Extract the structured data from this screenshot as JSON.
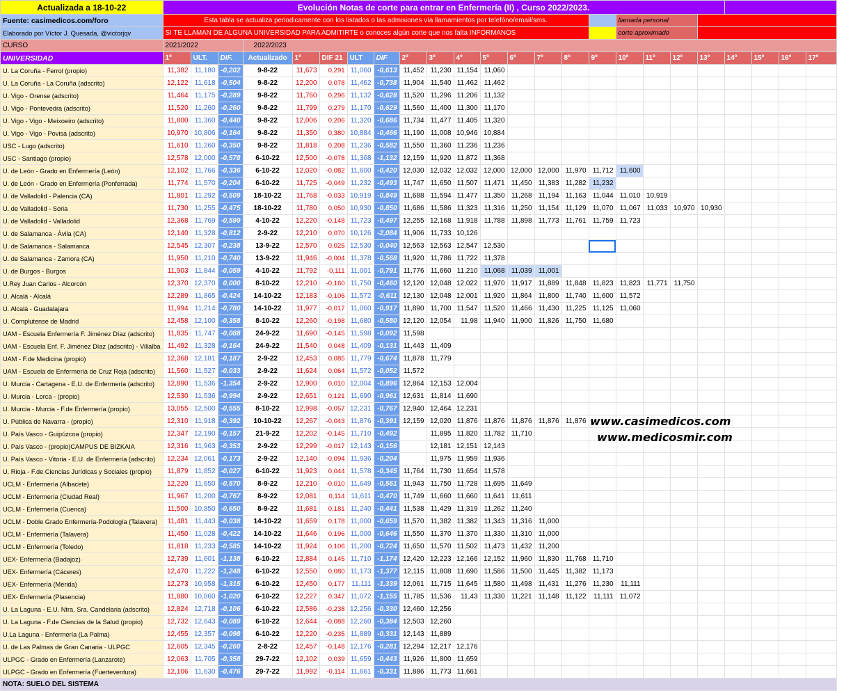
{
  "header": {
    "updated": "Actualizada a 18-10-22",
    "title": "Evolución Notas de corte para entrar en Enfermería (II) , Curso 2022/2023.",
    "source": "Fuente: casimedicos.com/foro",
    "note1": "Esta tabla se actualiza periodicamente con los listados o las admisiones vía llamamientos por telefóno/email/sms.",
    "author": "Elaborado por Víctor J. Quesada, @victorjqv",
    "note2": "SI TE LLAMAN DE ALGUNA UNIVERSIDAD PARA ADMITIRTE o conoces algún corte que nos falta INFÓRMANOS",
    "legend_personal": "llamada personal",
    "legend_aprox": "corte aproximado",
    "curso_label": "CURSO",
    "curso_prev": "2021/2022",
    "curso_curr": "2022/2023"
  },
  "columns": {
    "uni": "UNIVERSIDAD",
    "first_prev": "1º",
    "last_prev": "ULT.",
    "dif_prev": "DIF.",
    "updated": "Actualizado",
    "first": "1º",
    "dif21": "DIF 21",
    "last": "ULT",
    "dif": "DIF",
    "calls": [
      "2º",
      "3º",
      "4º",
      "5º",
      "6º",
      "7º",
      "8º",
      "9º",
      "10º",
      "11º",
      "12º",
      "13º",
      "14º",
      "15º",
      "16º",
      "17º"
    ]
  },
  "rows": [
    {
      "name": "U. La Coruña - Ferrol  (propio)",
      "p1": "11,382",
      "pu": "11,180",
      "pd": "-0,202",
      "upd": "9-8-22",
      "c1": "11,673",
      "d21": "0,291",
      "cu": "11,060",
      "cd": "-0,613",
      "calls": [
        "11,452",
        "11,230",
        "11,154",
        "11,060"
      ]
    },
    {
      "name": "U. La Coruña - La Coruña (adscrito)",
      "p1": "12,122",
      "pu": "11,618",
      "pd": "-0,504",
      "upd": "9-8-22",
      "c1": "12,200",
      "d21": "0,078",
      "cu": "11,462",
      "cd": "-0,738",
      "calls": [
        "11,904",
        "11,540",
        "11,462",
        "11,462"
      ]
    },
    {
      "name": "U. Vigo - Orense (adscrito)",
      "p1": "11,464",
      "pu": "11,175",
      "pd": "-0,289",
      "upd": "9-8-22",
      "c1": "11,760",
      "d21": "0,296",
      "cu": "11,132",
      "cd": "-0,628",
      "calls": [
        "11,520",
        "11,296",
        "11,206",
        "11,132"
      ]
    },
    {
      "name": "U. Vigo - Pontevedra (adscrito)",
      "p1": "11,520",
      "pu": "11,260",
      "pd": "-0,260",
      "upd": "9-8-22",
      "c1": "11,799",
      "d21": "0,279",
      "cu": "11,170",
      "cd": "-0,629",
      "calls": [
        "11,560",
        "11,400",
        "11,300",
        "11,170"
      ]
    },
    {
      "name": "U. Vigo - Vigo - Meixoeiro (adscrito)",
      "p1": "11,800",
      "pu": "11,360",
      "pd": "-0,440",
      "upd": "9-8-22",
      "c1": "12,006",
      "d21": "0,206",
      "cu": "11,320",
      "cd": "-0,686",
      "calls": [
        "11,734",
        "11,477",
        "11,405",
        "11,320"
      ]
    },
    {
      "name": "U. Vigo - Vigo - Povisa (adscrito)",
      "p1": "10,970",
      "pu": "10,806",
      "pd": "-0,164",
      "upd": "9-8-22",
      "c1": "11,350",
      "d21": "0,380",
      "cu": "10,884",
      "cd": "-0,466",
      "calls": [
        "11,190",
        "11,008",
        "10,946",
        "10,884"
      ]
    },
    {
      "name": "USC - Lugo  (adscrito)",
      "p1": "11,610",
      "pu": "11,260",
      "pd": "-0,350",
      "upd": "9-8-22",
      "c1": "11,818",
      "d21": "0,208",
      "cu": "11,236",
      "cd": "-0,582",
      "calls": [
        "11,550",
        "11,360",
        "11,236",
        "11,236"
      ]
    },
    {
      "name": "USC - Santiago  (propio)",
      "p1": "12,578",
      "pu": "12,000",
      "pd": "-0,578",
      "upd": "6-10-22",
      "c1": "12,500",
      "d21": "-0,078",
      "cu": "11,368",
      "cd": "-1,132",
      "calls": [
        "12,159",
        "11,920",
        "11,872",
        "11,368"
      ]
    },
    {
      "name": "U. de León - Grado en Enfermería (León)",
      "p1": "12,102",
      "pu": "11,766",
      "pd": "-0,336",
      "upd": "6-10-22",
      "c1": "12,020",
      "d21": "-0,082",
      "cu": "11,600",
      "cd": "-0,420",
      "calls": [
        "12,030",
        "12,032",
        "12,032",
        "12,000",
        "12,000",
        "12,000",
        "11,970",
        "11,712",
        "11,600"
      ],
      "hl": [
        8
      ]
    },
    {
      "name": "U. de León - Grado en Enfermería (Ponferrada)",
      "p1": "11,774",
      "pu": "11,570",
      "pd": "-0,204",
      "upd": "6-10-22",
      "c1": "11,725",
      "d21": "-0,049",
      "cu": "11,232",
      "cd": "-0,493",
      "calls": [
        "11,747",
        "11,650",
        "11,507",
        "11,471",
        "11,450",
        "11,383",
        "11,282",
        "11,232"
      ],
      "hl": [
        7
      ]
    },
    {
      "name": "U. de Valladolid - Palencia (CA)",
      "p1": "11,801",
      "pu": "11,292",
      "pd": "-0,509",
      "upd": "18-10-22",
      "c1": "11,768",
      "d21": "-0,033",
      "cu": "10,919",
      "cd": "-0,849",
      "calls": [
        "11,688",
        "11,594",
        "11,477",
        "11,350",
        "11,268",
        "11,194",
        "11,163",
        "11,044",
        "11,010",
        "10,919"
      ]
    },
    {
      "name": "U. de Valladolid - Soria",
      "p1": "11,730",
      "pu": "11,255",
      "pd": "-0,475",
      "upd": "18-10-22",
      "c1": "11,780",
      "d21": "0,050",
      "cu": "10,930",
      "cd": "-0,850",
      "calls": [
        "11,686",
        "11,586",
        "11,323",
        "11,316",
        "11,250",
        "11,154",
        "11,129",
        "11,070",
        "11,067",
        "11,033",
        "10,970",
        "10,930"
      ]
    },
    {
      "name": "U. de Valladolid - Valladolid",
      "p1": "12,368",
      "pu": "11,769",
      "pd": "-0,599",
      "upd": "4-10-22",
      "c1": "12,220",
      "d21": "-0,148",
      "cu": "11,723",
      "cd": "-0,497",
      "calls": [
        "12,255",
        "12,168",
        "11,918",
        "11,788",
        "11,898",
        "11,773",
        "11,761",
        "11,759",
        "11,723"
      ]
    },
    {
      "name": "U. de Salamanca - Ávila (CA)",
      "p1": "12,140",
      "pu": "11,328",
      "pd": "-0,812",
      "upd": "2-9-22",
      "c1": "12,210",
      "d21": "0,070",
      "cu": "10,126",
      "cd": "-2,084",
      "calls": [
        "11,906",
        "11,733",
        "10,126"
      ]
    },
    {
      "name": "U. de Salamanca - Salamanca",
      "p1": "12,545",
      "pu": "12,307",
      "pd": "-0,238",
      "upd": "13-9-22",
      "c1": "12,570",
      "d21": "0,025",
      "cu": "12,530",
      "cd": "-0,040",
      "calls": [
        "12,563",
        "12,563",
        "12,547",
        "12,530"
      ]
    },
    {
      "name": "U. de Salamanca - Zamora (CA)",
      "p1": "11,950",
      "pu": "11,210",
      "pd": "-0,740",
      "upd": "13-9-22",
      "c1": "11,946",
      "d21": "-0,004",
      "cu": "11,378",
      "cd": "-0,568",
      "calls": [
        "11,920",
        "11,786",
        "11,722",
        "11,378"
      ]
    },
    {
      "name": "U. de Burgos - Burgos",
      "p1": "11,903",
      "pu": "11,844",
      "pd": "-0,059",
      "upd": "4-10-22",
      "c1": "11,792",
      "d21": "-0,111",
      "cu": "11,001",
      "cd": "-0,791",
      "calls": [
        "11,776",
        "11,660",
        "11,210",
        "11,068",
        "11,039",
        "11,001"
      ],
      "hl": [
        3,
        4,
        5
      ]
    },
    {
      "name": "U.Rey Juan Carlos - Alcorcón",
      "p1": "12,370",
      "pu": "12,370",
      "pd": "0,000",
      "upd": "8-10-22",
      "c1": "12,210",
      "d21": "-0,160",
      "cu": "11,750",
      "cd": "-0,460",
      "calls": [
        "12,120",
        "12,048",
        "12,022",
        "11,970",
        "11,917",
        "11,889",
        "11,848",
        "11,823",
        "11,823",
        "11,771",
        "11,750"
      ]
    },
    {
      "name": "U. Alcalá - Alcalá",
      "p1": "12,289",
      "pu": "11,865",
      "pd": "-0,424",
      "upd": "14-10-22",
      "c1": "12,183",
      "d21": "-0,106",
      "cu": "11,572",
      "cd": "-0,611",
      "calls": [
        "12,130",
        "12,048",
        "12,001",
        "11,920",
        "11,864",
        "11,800",
        "11,740",
        "11,600",
        "11,572"
      ]
    },
    {
      "name": "U. Alcalá - Guadalajara",
      "p1": "11,994",
      "pu": "11,214",
      "pd": "-0,780",
      "upd": "14-10-22",
      "c1": "11,977",
      "d21": "-0,017",
      "cu": "11,060",
      "cd": "-0,917",
      "calls": [
        "11,890",
        "11,700",
        "11,547",
        "11,520",
        "11,466",
        "11,430",
        "11,225",
        "11,125",
        "11,060"
      ]
    },
    {
      "name": "U. Complutense de Madrid",
      "p1": "12,458",
      "pu": "12,100",
      "pd": "-0,358",
      "upd": "8-10-22",
      "c1": "12,260",
      "d21": "-0,198",
      "cu": "11,680",
      "cd": "-0,580",
      "calls": [
        "12,120",
        "12,054",
        "11,98",
        "11,940",
        "11,900",
        "11,826",
        "11,750",
        "11,680"
      ]
    },
    {
      "name": "UAM - Escuela Enfermería F. Jiménez Díaz (adscrito)",
      "p1": "11,835",
      "pu": "11,747",
      "pd": "-0,088",
      "upd": "24-9-22",
      "c1": "11,690",
      "d21": "-0,145",
      "cu": "11,598",
      "cd": "-0,092",
      "calls": [
        "11,598"
      ]
    },
    {
      "name": "UAM - Escuela Enf. F. Jiménez Díaz (adscrito) - Villalba",
      "p1": "11,492",
      "pu": "11,328",
      "pd": "-0,164",
      "upd": "24-9-22",
      "c1": "11,540",
      "d21": "0,048",
      "cu": "11,409",
      "cd": "-0,131",
      "calls": [
        "11,443",
        "11,409"
      ]
    },
    {
      "name": "UAM - F.de Medicina (propio)",
      "p1": "12,368",
      "pu": "12,181",
      "pd": "-0,187",
      "upd": "2-9-22",
      "c1": "12,453",
      "d21": "0,085",
      "cu": "11,779",
      "cd": "-0,674",
      "calls": [
        "11,878",
        "11,779"
      ]
    },
    {
      "name": "UAM - Escuela de Enfermería de Cruz Roja (adscrito)",
      "p1": "11,560",
      "pu": "11,527",
      "pd": "-0,033",
      "upd": "2-9-22",
      "c1": "11,624",
      "d21": "0,064",
      "cu": "11,572",
      "cd": "-0,052",
      "calls": [
        "11,572"
      ]
    },
    {
      "name": "U. Murcia - Cartagena - E.U. de Enfermería (adscrito)",
      "p1": "12,890",
      "pu": "11,536",
      "pd": "-1,354",
      "upd": "2-9-22",
      "c1": "12,900",
      "d21": "0,010",
      "cu": "12,004",
      "cd": "-0,896",
      "calls": [
        "12,864",
        "12,153",
        "12,004"
      ]
    },
    {
      "name": "U. Murcia - Lorca - (propio)",
      "p1": "12,530",
      "pu": "11,536",
      "pd": "-0,994",
      "upd": "2-9-22",
      "c1": "12,651",
      "d21": "0,121",
      "cu": "11,690",
      "cd": "-0,961",
      "calls": [
        "12,631",
        "11,814",
        "11,690"
      ]
    },
    {
      "name": "U. Murcia - Murcia - F.de Enfermería (propio)",
      "p1": "13,055",
      "pu": "12,500",
      "pd": "-0,555",
      "upd": "8-10-22",
      "c1": "12,998",
      "d21": "-0,057",
      "cu": "12,231",
      "cd": "-0,767",
      "calls": [
        "12,940",
        "12,464",
        "12,231"
      ]
    },
    {
      "name": "U. Pública de Navarra - (propio)",
      "p1": "12,310",
      "pu": "11,918",
      "pd": "-0,392",
      "upd": "10-10-22",
      "c1": "12,267",
      "d21": "-0,043",
      "cu": "11,876",
      "cd": "-0,391",
      "calls": [
        "12,159",
        "12,020",
        "11,876",
        "11,876",
        "11,876",
        "11,876",
        "11,876"
      ]
    },
    {
      "name": "U. País Vasco - Guipúzcoa (propio)",
      "p1": "12,347",
      "pu": "12,190",
      "pd": "-0,157",
      "upd": "21-9-22",
      "c1": "12,202",
      "d21": "-0,145",
      "cu": "11,710",
      "cd": "-0,492",
      "calls": [
        "",
        "11,895",
        "11,820",
        "11,782",
        "11,710"
      ]
    },
    {
      "name": "U. País Vasco - (propio)CAMPUS DE BIZKAIA",
      "p1": "12,316",
      "pu": "11,963",
      "pd": "-0,353",
      "upd": "2-9-22",
      "c1": "12,299",
      "d21": "-0,017",
      "cu": "12,143",
      "cd": "-0,156",
      "calls": [
        "",
        "12,181",
        "12,151",
        "12,143"
      ]
    },
    {
      "name": "U. País Vasco - Vitoria - E.U. de Enfermería (adscrito)",
      "p1": "12,234",
      "pu": "12,061",
      "pd": "-0,173",
      "upd": "2-9-22",
      "c1": "12,140",
      "d21": "-0,094",
      "cu": "11,936",
      "cd": "-0,204",
      "calls": [
        "",
        "11,975",
        "11,959",
        "11,936"
      ]
    },
    {
      "name": "U. Rioja - F.de Ciencias Jurídicas y Sociales (propio)",
      "p1": "11,879",
      "pu": "11,852",
      "pd": "-0,027",
      "upd": "6-10-22",
      "c1": "11,923",
      "d21": "0,044",
      "cu": "11,578",
      "cd": "-0,345",
      "calls": [
        "11,764",
        "11,730",
        "11,654",
        "11,578"
      ]
    },
    {
      "name": "UCLM - Enfermería (Albacete)",
      "p1": "12,220",
      "pu": "11,650",
      "pd": "-0,570",
      "upd": "8-9-22",
      "c1": "12,210",
      "d21": "-0,010",
      "cu": "11,649",
      "cd": "-0,561",
      "calls": [
        "11,943",
        "11,750",
        "11,728",
        "11,695",
        "11,649"
      ]
    },
    {
      "name": "UCLM - Enfermería (Ciudad Real)",
      "p1": "11,967",
      "pu": "11,200",
      "pd": "-0,767",
      "upd": "8-9-22",
      "c1": "12,081",
      "d21": "0,114",
      "cu": "11,611",
      "cd": "-0,470",
      "calls": [
        "11,749",
        "11,660",
        "11,660",
        "11,641",
        "11,611"
      ]
    },
    {
      "name": "UCLM - Enfermería (Cuenca)",
      "p1": "11,500",
      "pu": "10,850",
      "pd": "-0,650",
      "upd": "8-9-22",
      "c1": "11,681",
      "d21": "0,181",
      "cu": "11,240",
      "cd": "-0,441",
      "calls": [
        "11,538",
        "11,429",
        "11,319",
        "11,262",
        "11,240"
      ]
    },
    {
      "name": "UCLM - Doble Grado Enfermería-Podología (Talavera)",
      "p1": "11,481",
      "pu": "11,443",
      "pd": "-0,038",
      "upd": "14-10-22",
      "c1": "11,659",
      "d21": "0,178",
      "cu": "11,000",
      "cd": "-0,659",
      "calls": [
        "11,570",
        "11,382",
        "11,382",
        "11,343",
        "11,316",
        "11,000"
      ]
    },
    {
      "name": "UCLM - Enfermería (Talavera)",
      "p1": "11,450",
      "pu": "11,028",
      "pd": "-0,422",
      "upd": "14-10-22",
      "c1": "11,646",
      "d21": "0,196",
      "cu": "11,000",
      "cd": "-0,646",
      "calls": [
        "11,550",
        "11,370",
        "11,370",
        "11,330",
        "11,310",
        "11,000"
      ]
    },
    {
      "name": "UCLM - Enfermería (Toledo)",
      "p1": "11,818",
      "pu": "11,233",
      "pd": "-0,585",
      "upd": "14-10-22",
      "c1": "11,924",
      "d21": "0,106",
      "cu": "11,200",
      "cd": "-0,724",
      "calls": [
        "11,650",
        "11,570",
        "11,502",
        "11,473",
        "11,432",
        "11,200"
      ]
    },
    {
      "name": "UEX- Enfermería (Badajoz)",
      "p1": "12,739",
      "pu": "11,601",
      "pd": "-1,138",
      "upd": "6-10-22",
      "c1": "12,884",
      "d21": "0,145",
      "cu": "11,710",
      "cd": "-1,174",
      "calls": [
        "12,420",
        "12,223",
        "12,166",
        "12,152",
        "11,960",
        "11,830",
        "11,768",
        "11,710"
      ]
    },
    {
      "name": "UEX- Enfermería (Cáceres)",
      "p1": "12,470",
      "pu": "11,222",
      "pd": "-1,248",
      "upd": "6-10-22",
      "c1": "12,550",
      "d21": "0,080",
      "cu": "11,173",
      "cd": "-1,377",
      "calls": [
        "12,115",
        "11,808",
        "11,690",
        "11,586",
        "11,500",
        "11,445",
        "11,382",
        "11,173"
      ]
    },
    {
      "name": "UEX- Enfermería (Mérida)",
      "p1": "12,273",
      "pu": "10,958",
      "pd": "-1,315",
      "upd": "6-10-22",
      "c1": "12,450",
      "d21": "0,177",
      "cu": "11,111",
      "cd": "-1,339",
      "calls": [
        "12,061",
        "11,715",
        "11,645",
        "11,580",
        "11,498",
        "11,431",
        "11,276",
        "11,230",
        "11,111"
      ]
    },
    {
      "name": "UEX- Enfermería (Plasencia)",
      "p1": "11,880",
      "pu": "10,860",
      "pd": "-1,020",
      "upd": "6-10-22",
      "c1": "12,227",
      "d21": "0,347",
      "cu": "11,072",
      "cd": "-1,155",
      "calls": [
        "11,785",
        "11,536",
        "11,43",
        "11,330",
        "11,221",
        "11,148",
        "11,122",
        "11,111",
        "11,072"
      ]
    },
    {
      "name": "U. La Laguna - E.U. Ntra. Sra. Candelaria (adscrito)",
      "p1": "12,824",
      "pu": "12,718",
      "pd": "-0,106",
      "upd": "6-10-22",
      "c1": "12,586",
      "d21": "-0,238",
      "cu": "12,256",
      "cd": "-0,330",
      "calls": [
        "12,460",
        "12,256"
      ]
    },
    {
      "name": "U. La Laguna - F.de Ciencias de la Salud (propio)",
      "p1": "12,732",
      "pu": "12,643",
      "pd": "-0,089",
      "upd": "6-10-22",
      "c1": "12,644",
      "d21": "-0,088",
      "cu": "12,260",
      "cd": "-0,384",
      "calls": [
        "12,503",
        "12,260"
      ]
    },
    {
      "name": "U.La Laguna - Enfermería (La Palma)",
      "p1": "12,455",
      "pu": "12,357",
      "pd": "-0,098",
      "upd": "6-10-22",
      "c1": "12,220",
      "d21": "-0,235",
      "cu": "11,889",
      "cd": "-0,331",
      "calls": [
        "12,143",
        "11,889"
      ]
    },
    {
      "name": "U. de Las Palmas de Gran Canaria · ULPGC",
      "p1": "12,605",
      "pu": "12,345",
      "pd": "-0,260",
      "upd": "2-8-22",
      "c1": "12,457",
      "d21": "-0,148",
      "cu": "12,176",
      "cd": "-0,281",
      "calls": [
        "12,294",
        "12,217",
        "12,176"
      ]
    },
    {
      "name": "ULPGC -  Grado en Enfermería (Lanzarote)",
      "p1": "12,063",
      "pu": "11,705",
      "pd": "-0,358",
      "upd": "29-7-22",
      "c1": "12,102",
      "d21": "0,039",
      "cu": "11,659",
      "cd": "-0,443",
      "calls": [
        "11,926",
        "11,800",
        "11,659"
      ]
    },
    {
      "name": "ULPGC -  Grado en Enfermería (Fuerteventura)",
      "p1": "12,106",
      "pu": "11,630",
      "pd": "-0,476",
      "upd": "29-7-22",
      "c1": "11,992",
      "d21": "-0,114",
      "cu": "11,661",
      "cd": "-0,331",
      "calls": [
        "11,886",
        "11,773",
        "11,661"
      ]
    }
  ],
  "footer": "NOTA: SUELO DEL SISTEMA",
  "watermarks": [
    "www.casimedicos.com",
    "www.medicosmir.com"
  ],
  "colors": {
    "purple": "#9900ff",
    "red": "#ff0000",
    "yellow": "#ffff00",
    "lightblue": "#a4c2f4",
    "salmon": "#e06666",
    "pink": "#ea9999",
    "cream": "#fff2cc",
    "dif": "#6d9eeb"
  }
}
